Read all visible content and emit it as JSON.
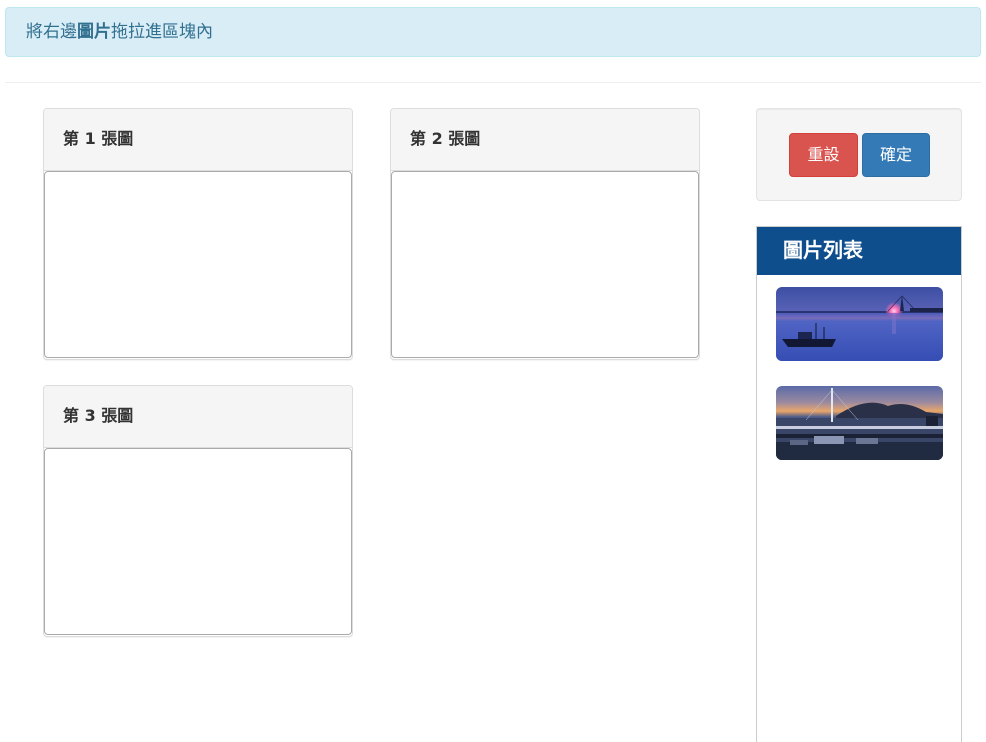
{
  "alert": {
    "prefix": "將右邊",
    "emphasis": "圖片",
    "suffix": "拖拉進區塊內"
  },
  "panels": [
    {
      "title": "第 1 張圖"
    },
    {
      "title": "第 2 張圖"
    },
    {
      "title": "第 3 張圖"
    }
  ],
  "actions": {
    "reset_label": "重設",
    "confirm_label": "確定"
  },
  "image_list": {
    "title": "圖片列表",
    "images": [
      {
        "name": "sunset-bridge-boat-photo"
      },
      {
        "name": "harbor-mountain-dusk-photo"
      }
    ]
  },
  "colors": {
    "alert_bg": "#d9edf7",
    "alert_text": "#31708f",
    "danger": "#d9534f",
    "primary": "#337ab7",
    "list_header": "#0f4e8c"
  }
}
